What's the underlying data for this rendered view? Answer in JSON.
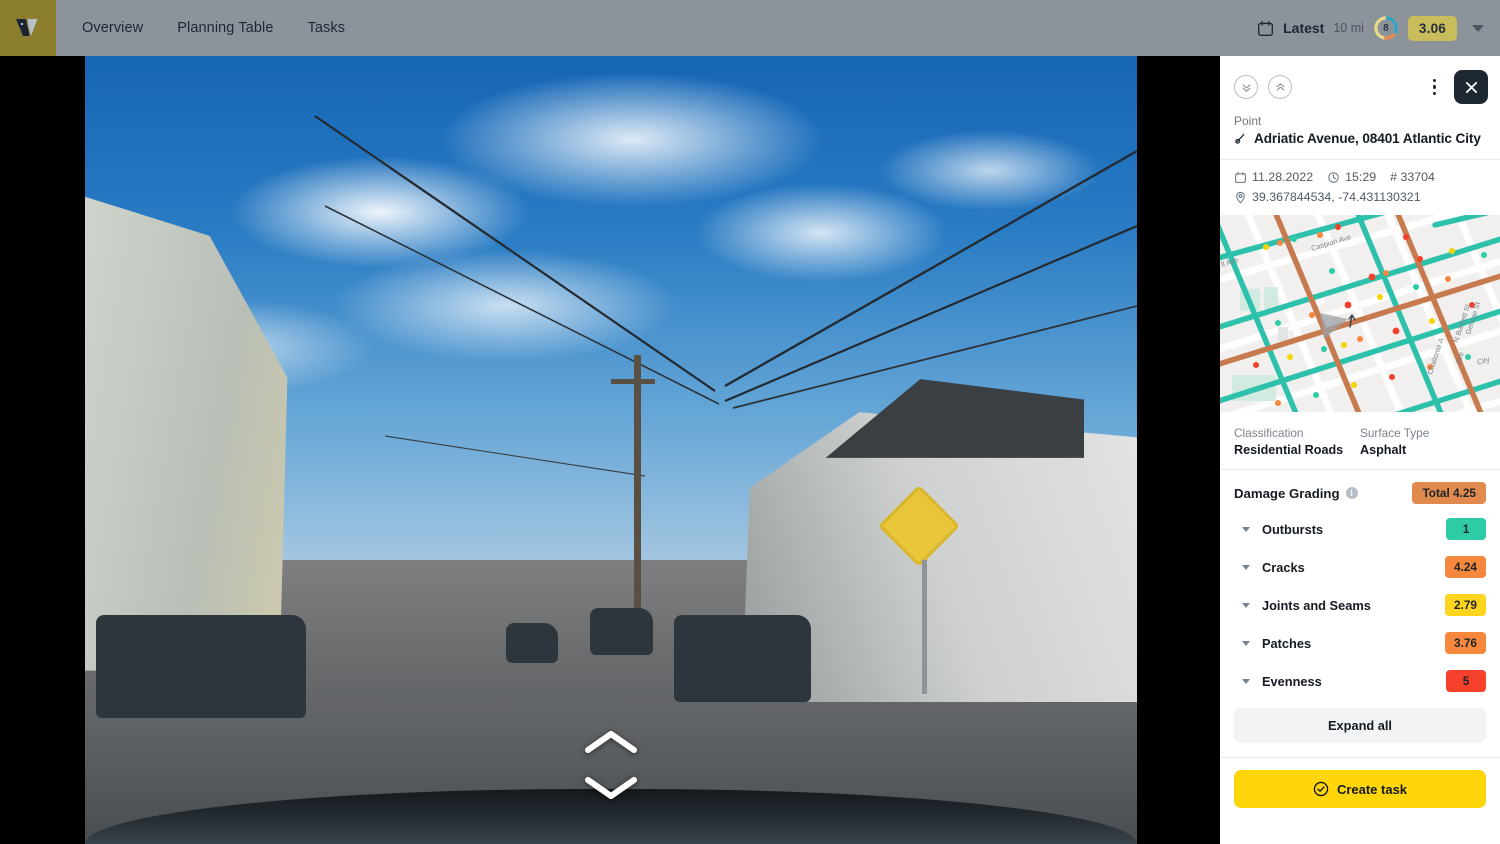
{
  "topbar": {
    "logo_alt": "vialytics-logo",
    "nav": [
      {
        "label": "Overview"
      },
      {
        "label": "Planning Table"
      },
      {
        "label": "Tasks"
      }
    ],
    "date_filter_label": "Latest",
    "distance": "10 mi",
    "donut_value": "8",
    "score": "3.06"
  },
  "panel": {
    "point_label": "Point",
    "point_title": "Adriatic Avenue, 08401 Atlantic City",
    "meta": {
      "date": "11.28.2022",
      "time": "15:29",
      "id": "# 33704",
      "coordinates": "39.367844534, -74.431130321"
    },
    "classification_label": "Classification",
    "classification_value": "Residential Roads",
    "surface_label": "Surface Type",
    "surface_value": "Asphalt",
    "damage_grading_title": "Damage Grading",
    "total_badge": "Total 4.25",
    "total_badge_color": "#e08a4e",
    "rows": [
      {
        "label": "Outbursts",
        "value": "1",
        "color": "#2dcca7"
      },
      {
        "label": "Cracks",
        "value": "4.24",
        "color": "#f5883c"
      },
      {
        "label": "Joints and Seams",
        "value": "2.79",
        "color": "#ffd41f"
      },
      {
        "label": "Patches",
        "value": "3.76",
        "color": "#f5883c"
      },
      {
        "label": "Evenness",
        "value": "5",
        "color": "#f5402c"
      }
    ],
    "expand_all_label": "Expand all",
    "create_task_label": "Create task"
  },
  "map": {
    "street_labels": [
      "Caspian Ave",
      "ll Ave",
      "George St",
      "N Bartlett St",
      "City",
      "Challonte A",
      "Ave"
    ],
    "road_color_good": "#2dc1ab",
    "road_color_bad": "#c77a4e"
  },
  "viewer": {
    "prev_alt": "previous-image",
    "next_alt": "next-image"
  }
}
